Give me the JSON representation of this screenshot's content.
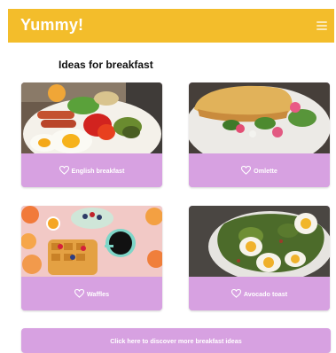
{
  "app": {
    "brand": "Yummy!",
    "menu_icon": "hamburger-menu-icon"
  },
  "page": {
    "section_title": "Ideas for breakfast"
  },
  "cards": [
    {
      "label": "English breakfast",
      "icon": "heart-outline-icon",
      "image": "plate of eggs, sausages, tomatoes, zucchini and salad"
    },
    {
      "label": "Omlette",
      "icon": "heart-outline-icon",
      "image": "folded omelette with spinach and radishes"
    },
    {
      "label": "Waffles",
      "icon": "heart-outline-icon",
      "image": "waffles with berries, coffee cup and flowers"
    },
    {
      "label": "Avocado toast",
      "icon": "heart-outline-icon",
      "image": "toast with avocado and boiled eggs"
    }
  ],
  "cta": {
    "label": "Click here to discover more breakfast ideas"
  },
  "colors": {
    "appbar": "#f3bd2b",
    "card": "#d7a1e1",
    "text_on_color": "#ffffff"
  }
}
